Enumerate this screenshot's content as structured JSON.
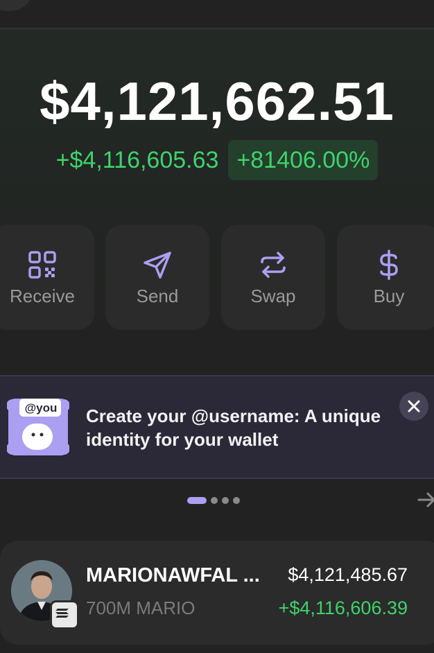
{
  "balance": {
    "total": "$4,121,662.51",
    "change_amount": "+$4,116,605.63",
    "change_percent": "+81406.00%"
  },
  "actions": [
    {
      "label": "Receive",
      "icon": "qr-code-icon"
    },
    {
      "label": "Send",
      "icon": "send-icon"
    },
    {
      "label": "Swap",
      "icon": "swap-icon"
    },
    {
      "label": "Buy",
      "icon": "dollar-icon"
    }
  ],
  "banner": {
    "art_label": "@you",
    "text": "Create your @username: A unique identity for your wallet"
  },
  "carousel": {
    "pages": 4,
    "active_index": 0
  },
  "token": {
    "name": "MARIONAWFAL ...",
    "amount": "700M MARIO",
    "value": "$4,121,485.67",
    "change": "+$4,116,606.39"
  },
  "colors": {
    "background": "#222222",
    "positive": "#3ed36b",
    "accent": "#ab9ff2",
    "banner_bg": "#2b2838"
  }
}
